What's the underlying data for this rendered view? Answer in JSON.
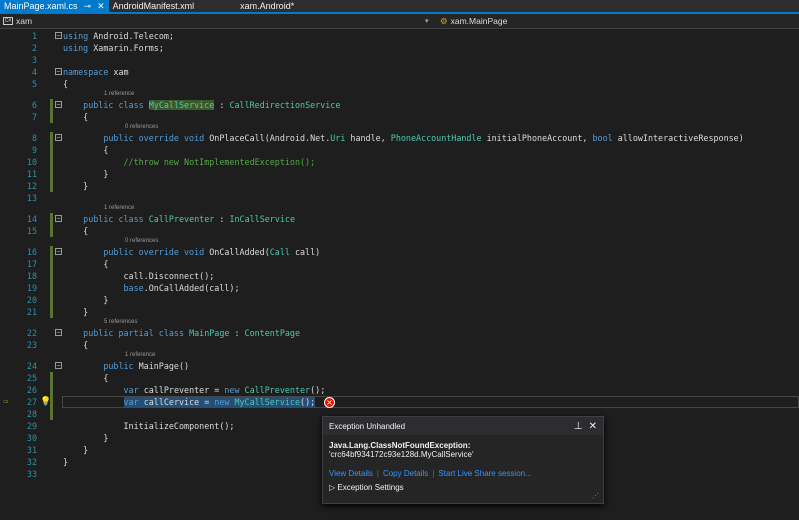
{
  "tabs": [
    {
      "label": "MainPage.xaml.cs",
      "active": true
    },
    {
      "label": "AndroidManifest.xml"
    },
    {
      "label": "xam.Android*"
    }
  ],
  "nav": {
    "left": "xam",
    "right": "xam.MainPage"
  },
  "lines": [
    {
      "n": "1",
      "fold": true,
      "tok": [
        [
          "using ",
          "k"
        ],
        [
          "Android.Telecom;",
          ""
        ]
      ]
    },
    {
      "n": "2",
      "tok": [
        [
          "using ",
          "k"
        ],
        [
          "Xamarin.Forms;",
          ""
        ]
      ]
    },
    {
      "n": "3",
      "tok": []
    },
    {
      "n": "4",
      "fold": true,
      "tok": [
        [
          "namespace ",
          "k"
        ],
        [
          "xam",
          ""
        ]
      ]
    },
    {
      "n": "5",
      "tok": [
        [
          "{",
          ""
        ]
      ]
    },
    {
      "n": "6",
      "fold": true,
      "lens": "1 reference",
      "ind": 1,
      "tok": [
        [
          "public class ",
          "k"
        ],
        [
          "MyCallService",
          "t hl"
        ],
        [
          " : ",
          ""
        ],
        [
          "CallRedirectionService",
          "t"
        ]
      ]
    },
    {
      "n": "7",
      "ind": 1,
      "tok": [
        [
          "{",
          ""
        ]
      ]
    },
    {
      "n": "8",
      "fold": true,
      "lens": "0 references",
      "ind": 2,
      "tok": [
        [
          "public override void ",
          "k"
        ],
        [
          "OnPlaceCall(Android.Net.",
          ""
        ],
        [
          "Uri",
          "t"
        ],
        [
          " handle, ",
          ""
        ],
        [
          "PhoneAccountHandle",
          "t"
        ],
        [
          " initialPhoneAccount, ",
          ""
        ],
        [
          "bool",
          "k"
        ],
        [
          " allowInteractiveResponse)",
          ""
        ]
      ]
    },
    {
      "n": "9",
      "ind": 2,
      "tok": [
        [
          "{",
          ""
        ]
      ]
    },
    {
      "n": "10",
      "ind": 3,
      "tok": [
        [
          "//throw new NotImplementedException();",
          "c"
        ]
      ]
    },
    {
      "n": "11",
      "ind": 2,
      "tok": [
        [
          "}",
          ""
        ]
      ]
    },
    {
      "n": "12",
      "ind": 1,
      "tok": [
        [
          "}",
          ""
        ]
      ]
    },
    {
      "n": "13",
      "tok": []
    },
    {
      "n": "14",
      "fold": true,
      "lens": "1 reference",
      "ind": 1,
      "tok": [
        [
          "public class ",
          "k"
        ],
        [
          "CallPreventer",
          "t"
        ],
        [
          " : ",
          ""
        ],
        [
          "InCallService",
          "t"
        ]
      ]
    },
    {
      "n": "15",
      "ind": 1,
      "tok": [
        [
          "{",
          ""
        ]
      ]
    },
    {
      "n": "16",
      "fold": true,
      "lens": "0 references",
      "ind": 2,
      "tok": [
        [
          "public override void ",
          "k"
        ],
        [
          "OnCallAdded(",
          ""
        ],
        [
          "Call",
          "t"
        ],
        [
          " call)",
          ""
        ]
      ]
    },
    {
      "n": "17",
      "ind": 2,
      "tok": [
        [
          "{",
          ""
        ]
      ]
    },
    {
      "n": "18",
      "ind": 3,
      "tok": [
        [
          "call.Disconnect();",
          ""
        ]
      ]
    },
    {
      "n": "19",
      "ind": 3,
      "tok": [
        [
          "base",
          "k"
        ],
        [
          ".OnCallAdded(call);",
          ""
        ]
      ]
    },
    {
      "n": "20",
      "ind": 2,
      "tok": [
        [
          "}",
          ""
        ]
      ]
    },
    {
      "n": "21",
      "ind": 1,
      "tok": [
        [
          "}",
          ""
        ]
      ]
    },
    {
      "n": "22",
      "fold": true,
      "lens": "5 references",
      "ind": 1,
      "tok": [
        [
          "public partial class ",
          "k"
        ],
        [
          "MainPage",
          "t"
        ],
        [
          " : ",
          ""
        ],
        [
          "ContentPage",
          "t"
        ]
      ]
    },
    {
      "n": "23",
      "ind": 1,
      "tok": [
        [
          "{",
          ""
        ]
      ]
    },
    {
      "n": "24",
      "fold": true,
      "lens": "1 reference",
      "ind": 2,
      "tok": [
        [
          "public ",
          "k"
        ],
        [
          "MainPage()",
          ""
        ]
      ]
    },
    {
      "n": "25",
      "ind": 2,
      "tok": [
        [
          "{",
          ""
        ]
      ]
    },
    {
      "n": "26",
      "ind": 3,
      "tok": [
        [
          "var ",
          "k"
        ],
        [
          "callPreventer = ",
          ""
        ],
        [
          "new ",
          "k"
        ],
        [
          "CallPreventer",
          "t"
        ],
        [
          "();",
          ""
        ]
      ]
    },
    {
      "n": "27",
      "ind": 3,
      "current": true,
      "tok": [
        [
          "var",
          "k sel"
        ],
        [
          " callCervice = ",
          "sel"
        ],
        [
          "new ",
          "k sel"
        ],
        [
          "MyCallService",
          "t sel"
        ],
        [
          "();",
          "sel"
        ]
      ]
    },
    {
      "n": "28",
      "ind": 3,
      "tok": []
    },
    {
      "n": "29",
      "ind": 3,
      "tok": [
        [
          "InitializeComponent();",
          ""
        ]
      ]
    },
    {
      "n": "30",
      "ind": 2,
      "tok": [
        [
          "}",
          ""
        ]
      ]
    },
    {
      "n": "31",
      "ind": 1,
      "tok": [
        [
          "}",
          ""
        ]
      ]
    },
    {
      "n": "32",
      "tok": [
        [
          "}",
          ""
        ]
      ]
    },
    {
      "n": "33",
      "tok": []
    }
  ],
  "popup": {
    "title": "Exception Unhandled",
    "exception": "Java.Lang.ClassNotFoundException:",
    "message": "'crc64bf934172c93e128d.MyCallService'",
    "links": [
      "View Details",
      "Copy Details",
      "Start Live Share session..."
    ],
    "settings": "Exception Settings"
  }
}
